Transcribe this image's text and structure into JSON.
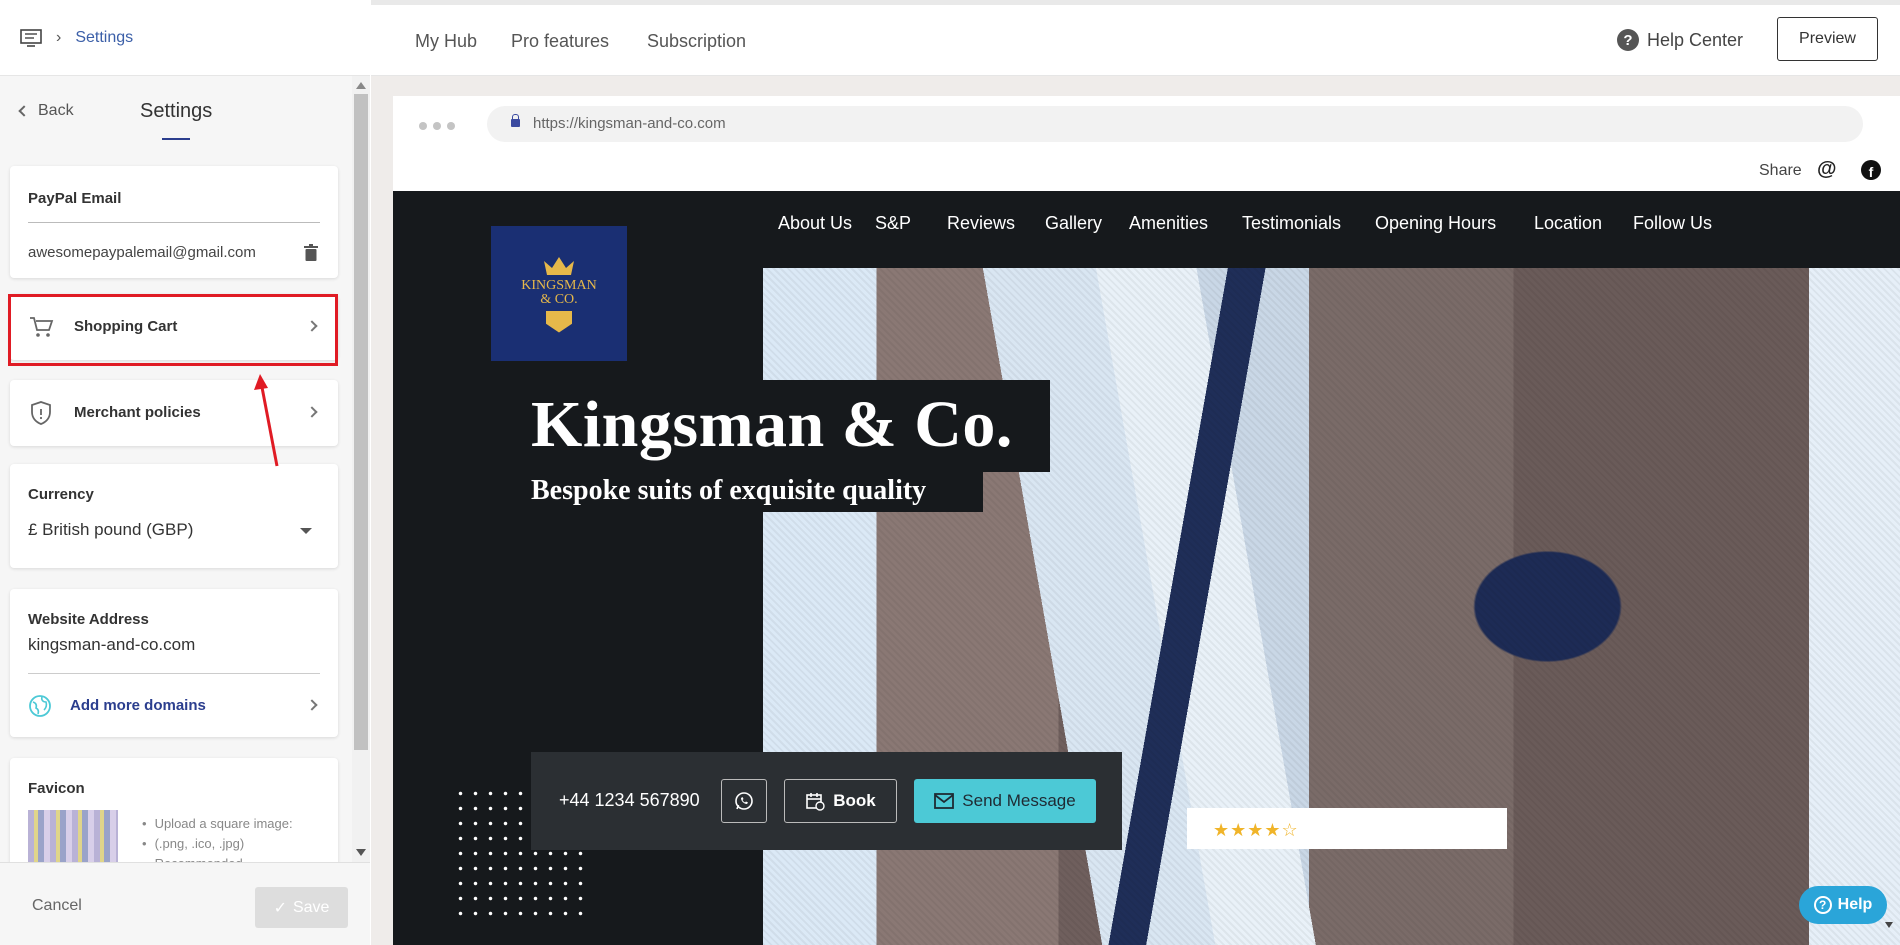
{
  "breadcrumb": {
    "label": "Settings"
  },
  "panel": {
    "back_label": "Back",
    "title": "Settings",
    "paypal": {
      "heading": "PayPal Email",
      "value": "awesomepaypalemail@gmail.com"
    },
    "shopping_cart": {
      "label": "Shopping Cart"
    },
    "merchant_policies": {
      "label": "Merchant policies"
    },
    "currency": {
      "heading": "Currency",
      "value": "£ British pound (GBP)"
    },
    "website": {
      "heading": "Website Address",
      "value": "kingsman-and-co.com",
      "add_domains": "Add more domains"
    },
    "favicon": {
      "heading": "Favicon",
      "hint1": "Upload a square image:",
      "hint2": "(.png, .ico, .jpg)",
      "hint3": "Recommended"
    },
    "cancel_label": "Cancel",
    "save_label": "Save"
  },
  "topnav": {
    "items": [
      "My Hub",
      "Pro features",
      "Subscription"
    ],
    "help_center": "Help Center",
    "preview": "Preview"
  },
  "browser": {
    "url": "https://kingsman-and-co.com",
    "share": "Share"
  },
  "site": {
    "nav": [
      "About Us",
      "S&P",
      "Reviews",
      "Gallery",
      "Amenities",
      "Testimonials",
      "Opening Hours",
      "Location",
      "Follow Us"
    ],
    "logo_line1": "KINGSMAN",
    "logo_line2": "& CO.",
    "hero_title": "Kingsman & Co.",
    "hero_subtitle": "Bespoke suits of exquisite quality",
    "phone": "+44 1234 567890",
    "book": "Book",
    "send_message": "Send Message",
    "rating_stars": 4.5
  },
  "help_button": "Help",
  "colors": {
    "accent": "#2b3e8e",
    "highlight": "#e01b24",
    "teal": "#4cc9d6",
    "help": "#2aa5d9"
  }
}
